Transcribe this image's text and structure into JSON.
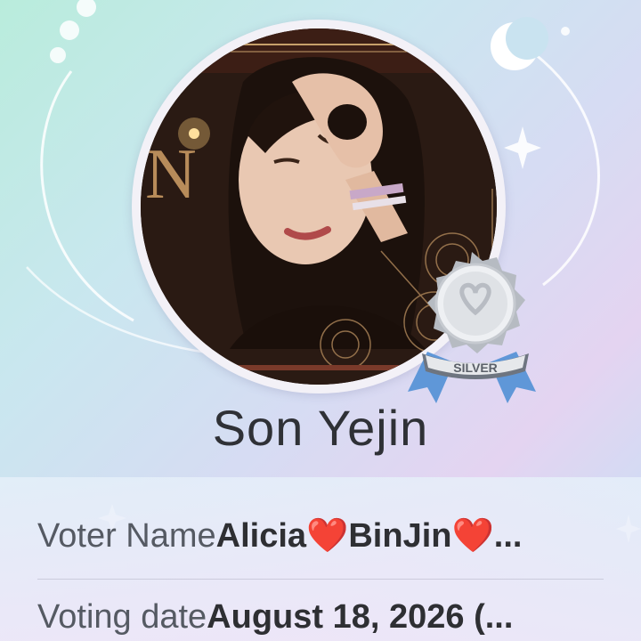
{
  "profile": {
    "name": "Son Yejin",
    "badge_label": "SILVER",
    "badge_color": "#c9cdd3",
    "ribbon_color": "#6fa5e0"
  },
  "details": {
    "voter_name_label": "Voter Name",
    "voter_name_value": "Alicia❤️BinJin❤️...",
    "voting_date_label": "Voting date",
    "voting_date_value": "August 18, 2026 (..."
  },
  "icons": {
    "moon": "moon-icon",
    "sparkle": "sparkle-icon"
  }
}
